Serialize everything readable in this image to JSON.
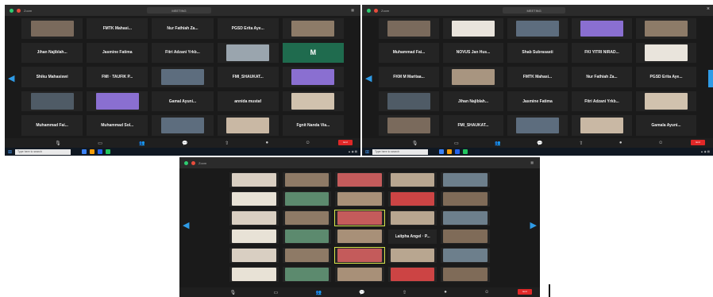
{
  "screens": {
    "a": {
      "title_url": "MEETING",
      "app": "Zoom",
      "rows": [
        [
          "",
          "FMTK Mahasi...",
          "Nur Fathiah Za...",
          "PGSD Erita Aye...",
          ""
        ],
        [
          "Jihan Najiblah...",
          "Jasmine Fatima",
          "Fitri Adzani Yrkb...",
          "",
          "M"
        ],
        [
          "Shiku Mahasiswi",
          "FMI · TAUFIK P...",
          "",
          "FMI_SHAUKAT...",
          ""
        ],
        [
          "",
          "",
          "Gamal Ayuni...",
          "annida mustaf",
          ""
        ],
        [
          "Muhammad Fai...",
          "Muhammad Sol...",
          "",
          "",
          "Fgnit Nanda Via..."
        ]
      ],
      "taskbar_search": "Type here to search"
    },
    "b": {
      "title_url": "MEETING",
      "app": "Zoom",
      "rows": [
        [
          "",
          "",
          "",
          "",
          ""
        ],
        [
          "Muhammad Fai...",
          "NOVUS Jan Hus...",
          "Shab Subrasasti",
          "FKI YITRI NIRAD...",
          ""
        ],
        [
          "FKM M Maritaa...",
          "",
          "FMTK Mahasi...",
          "Nur Fathiah Za...",
          "PGSD Erita Aye..."
        ],
        [
          "",
          "Jihan Najiblah...",
          "Jasmine Fatima",
          "Fitri Adzani Yrkb...",
          ""
        ],
        [
          "",
          "FMI_SHAUKAT...",
          "",
          "",
          "Gamala Ayuni..."
        ]
      ],
      "taskbar_search": "Type here to search"
    },
    "c": {
      "title_url": "",
      "app": "Zoom",
      "named_tile": "Laitpha Angel · P..."
    }
  },
  "controls": [
    "Mute",
    "Video",
    "Participants",
    "Chat",
    "Share Screen",
    "Record",
    "Reactions"
  ],
  "end_label": "End",
  "colors": {
    "accent": "#2f9be6",
    "speaker": "#d6e34a",
    "end": "#e02828",
    "bg": "#1a1a1a"
  }
}
